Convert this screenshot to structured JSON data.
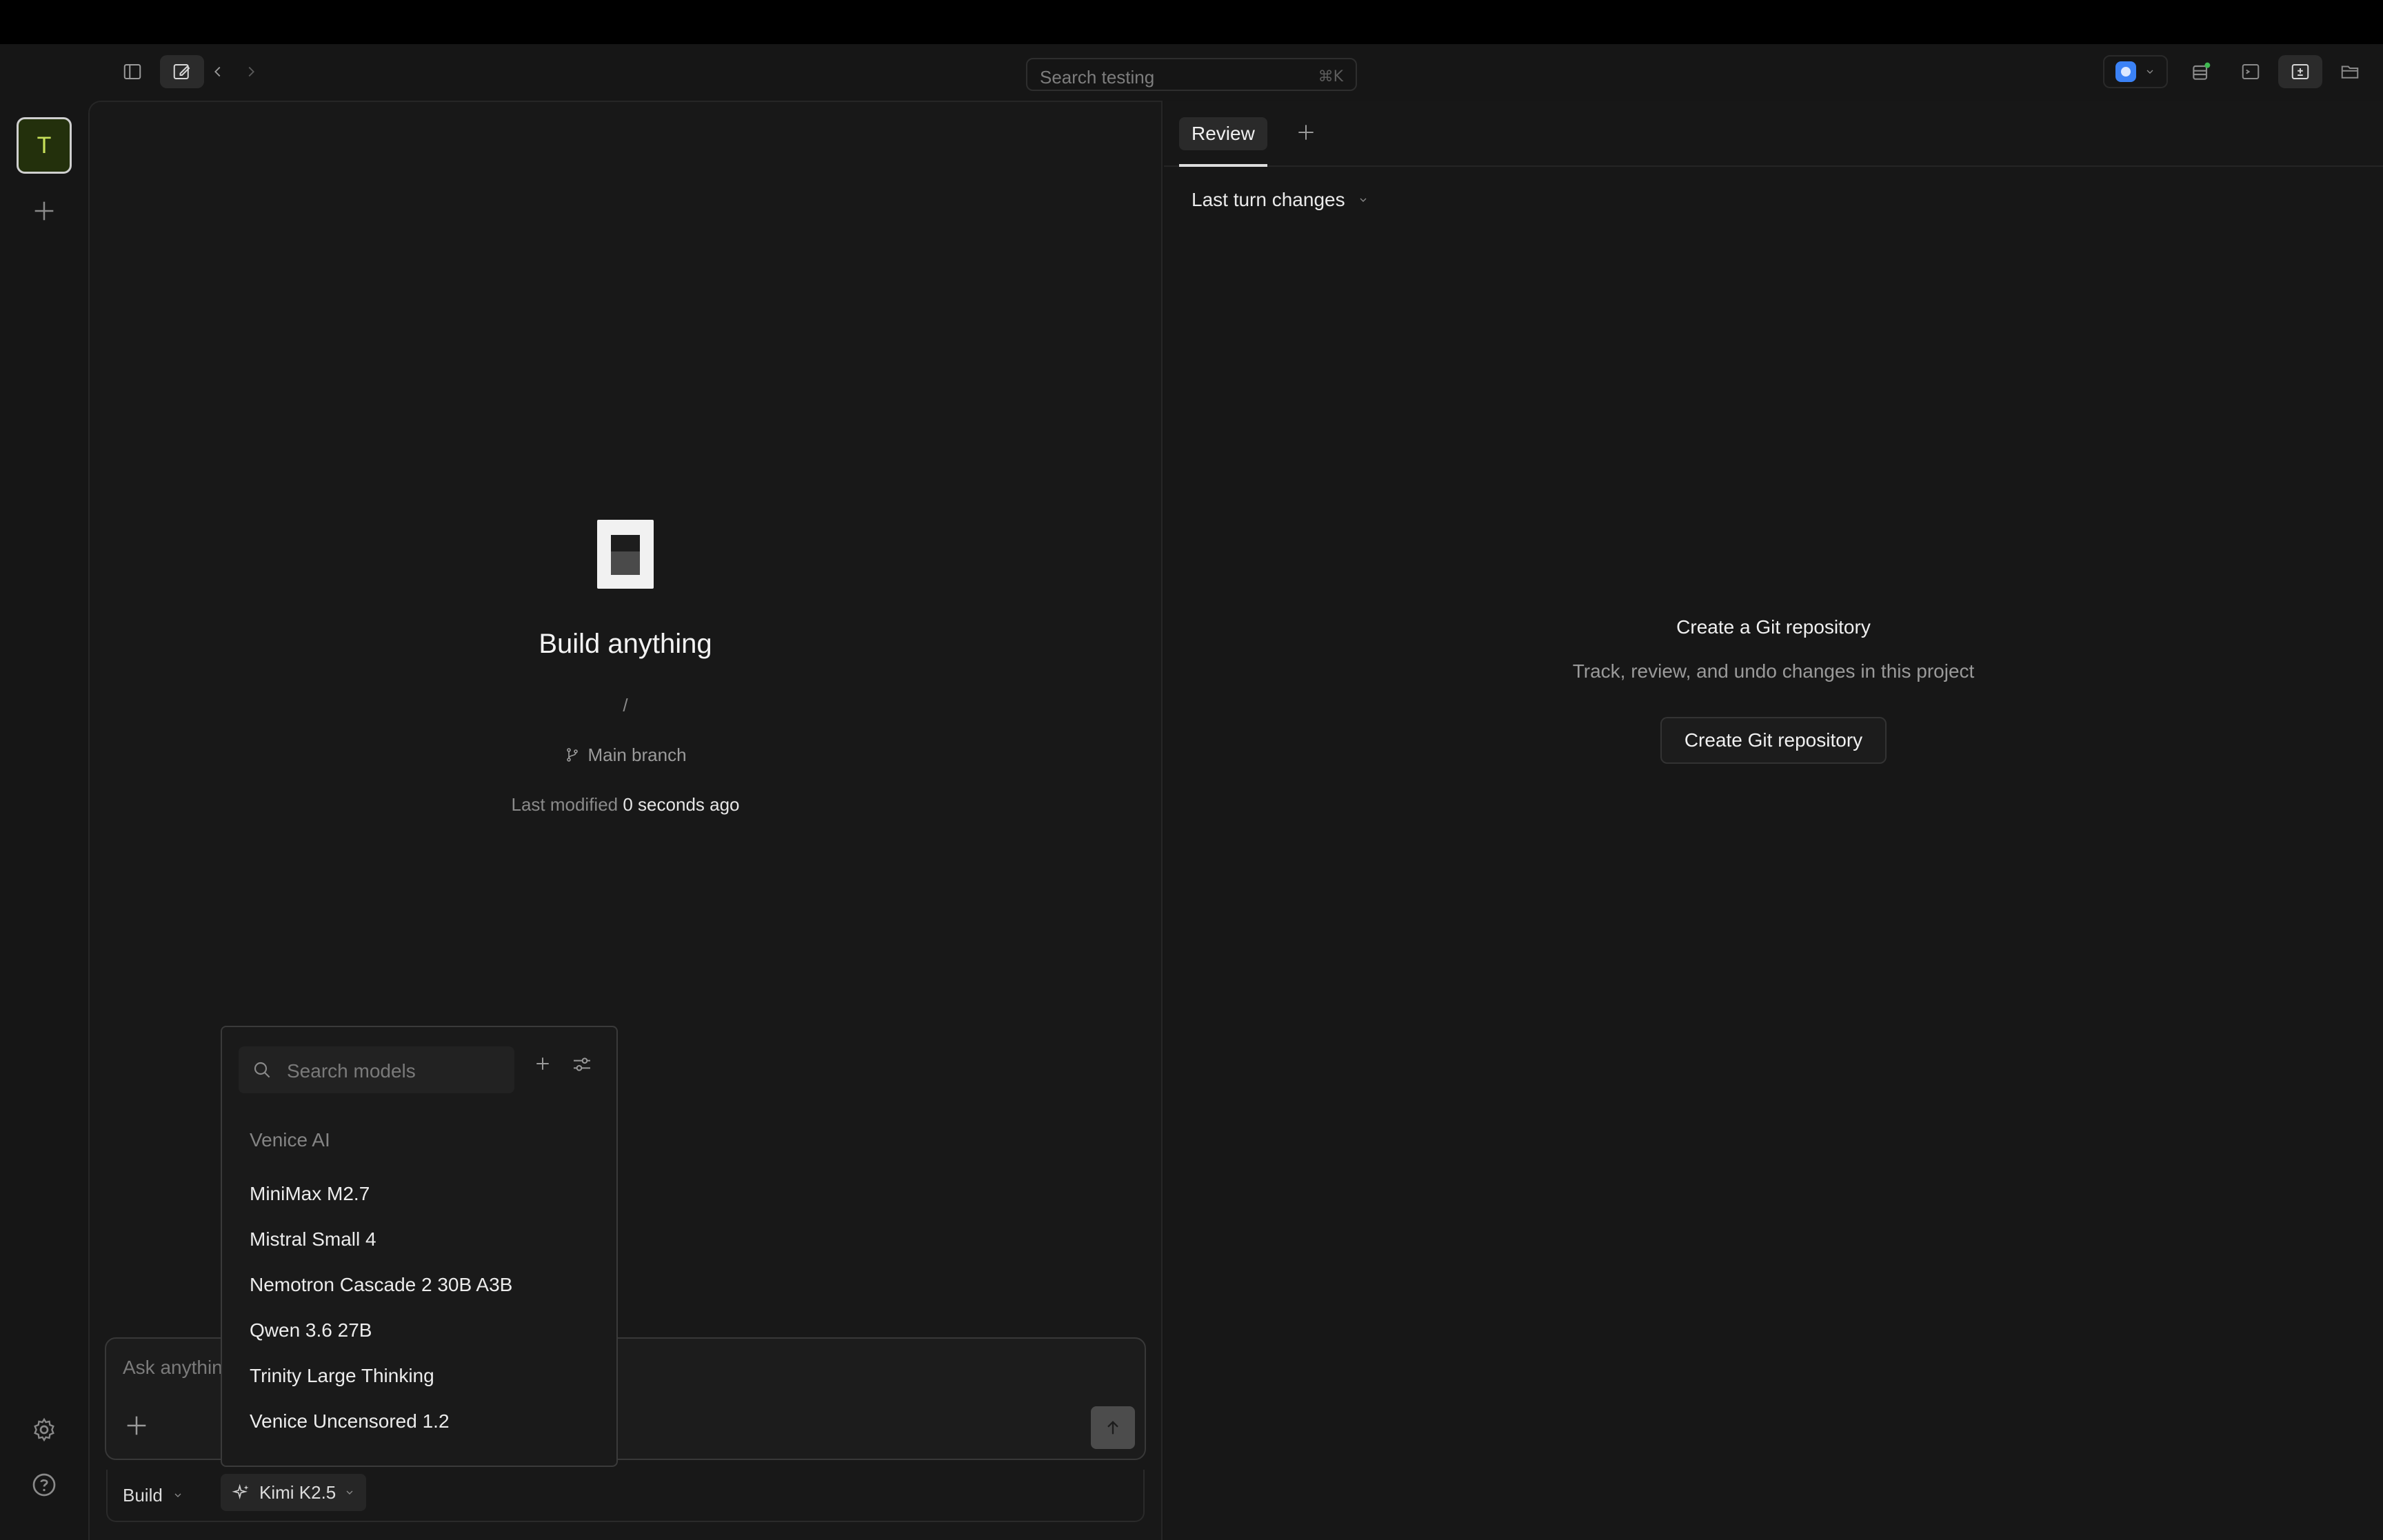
{
  "titlebar": {
    "search_placeholder": "Search testing",
    "search_shortcut": "⌘K"
  },
  "rail": {
    "project_initial": "T"
  },
  "hero": {
    "title": "Build anything",
    "path": "/",
    "branch": "Main branch",
    "modified_label": "Last modified",
    "modified_value": "0 seconds ago"
  },
  "composer": {
    "placeholder": "Ask anything",
    "mode": "Build",
    "model": "Kimi K2.5"
  },
  "model_menu": {
    "search_placeholder": "Search models",
    "provider": "Venice AI",
    "models": [
      "MiniMax M2.7",
      "Mistral Small 4",
      "Nemotron Cascade 2 30B A3B",
      "Qwen 3.6 27B",
      "Trinity Large Thinking",
      "Venice Uncensored 1.2"
    ]
  },
  "review": {
    "tab_label": "Review",
    "changes_filter": "Last turn changes",
    "empty_title": "Create a Git repository",
    "empty_subtitle": "Track, review, and undo changes in this project",
    "create_button": "Create Git repository"
  },
  "colors": {
    "background": "#161616",
    "avatar_bg": "#23300c",
    "avatar_fg": "#c7e05a",
    "status_dot": "#3fb950",
    "accent_blue": "#3b82f6"
  }
}
